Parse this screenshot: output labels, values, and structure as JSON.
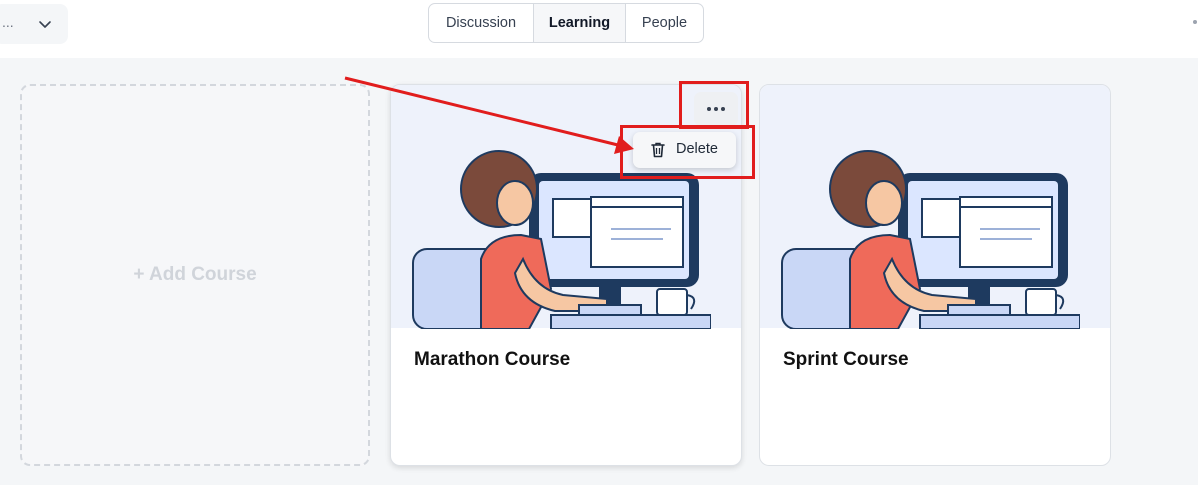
{
  "top_left_select": {
    "value": "..."
  },
  "tabs": [
    {
      "label": "Discussion",
      "active": false
    },
    {
      "label": "Learning",
      "active": true
    },
    {
      "label": "People",
      "active": false
    }
  ],
  "add_course": {
    "label": "+ Add Course"
  },
  "courses": [
    {
      "title": "Marathon Course"
    },
    {
      "title": "Sprint Course"
    }
  ],
  "context_menu": {
    "items": [
      {
        "label": "Delete",
        "icon": "trash-icon"
      }
    ]
  },
  "colors": {
    "accent_red": "#e11d1d",
    "page_bg": "#f4f6f8",
    "thumb_bg": "#eef2fb",
    "shirt": "#ef6a5a",
    "screen_frame": "#1e3a5f"
  }
}
